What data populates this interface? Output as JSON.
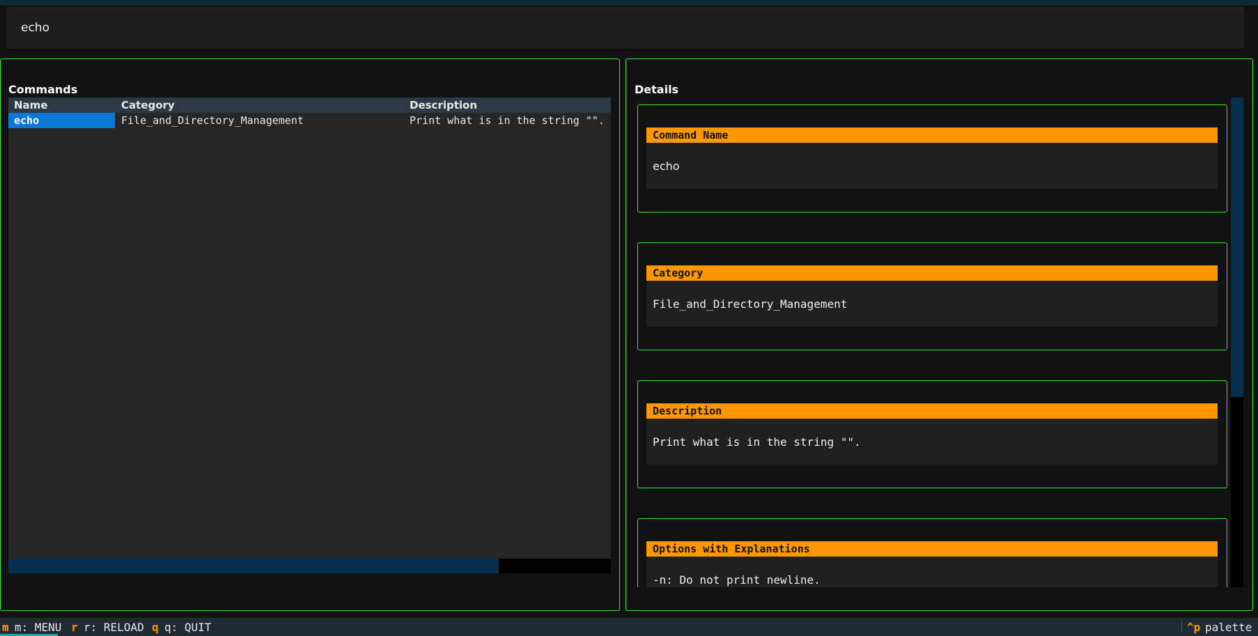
{
  "search": {
    "value": "echo"
  },
  "commands": {
    "title": "Commands",
    "columns": [
      "Name",
      "Category",
      "Description"
    ],
    "rows": [
      {
        "name": "echo",
        "category": "File_and_Directory_Management",
        "description": "Print what is in the string \"\"."
      }
    ]
  },
  "details": {
    "title": "Details",
    "sections": [
      {
        "label": "Command Name",
        "value": "echo"
      },
      {
        "label": "Category",
        "value": "File_and_Directory_Management"
      },
      {
        "label": "Description",
        "value": "Print what is in the string \"\"."
      },
      {
        "label": "Options with Explanations",
        "value": "-n: Do not print newline."
      }
    ]
  },
  "footer": {
    "menu_key": "m",
    "menu_label": "m: MENU",
    "reload_key": "r",
    "reload_label": "r: RELOAD",
    "quit_key": "q",
    "quit_label": "q: QUIT",
    "palette_key": "^p",
    "palette_label": "palette"
  },
  "colors": {
    "accent_border": "#3ce83c",
    "section_header": "#ff9800",
    "selection": "#0c78d6",
    "footer_key": "#ff9800"
  }
}
